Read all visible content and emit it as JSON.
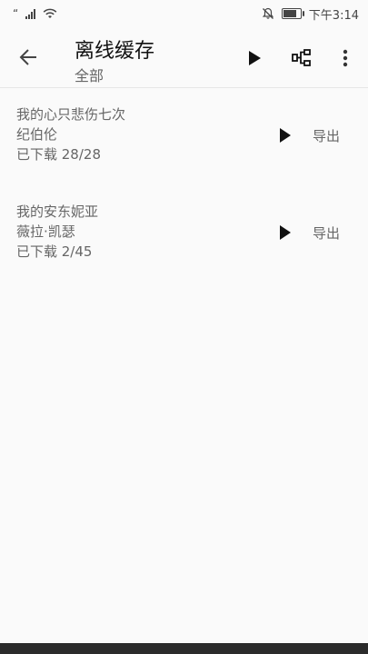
{
  "status_bar": {
    "carrier_mark": "“",
    "time": "下午3:14"
  },
  "app_bar": {
    "title": "离线缓存",
    "subtitle": "全部"
  },
  "items": [
    {
      "title": "我的心只悲伤七次",
      "artist": "纪伯伦",
      "progress": "已下载 28/28",
      "export_label": "导出"
    },
    {
      "title": "我的安东妮亚",
      "artist": "薇拉·凯瑟",
      "progress": "已下载 2/45",
      "export_label": "导出"
    }
  ],
  "icons": {
    "back": "arrow-left-icon",
    "play": "play-icon",
    "tree": "tree-structure-icon",
    "more": "more-vertical-icon"
  }
}
